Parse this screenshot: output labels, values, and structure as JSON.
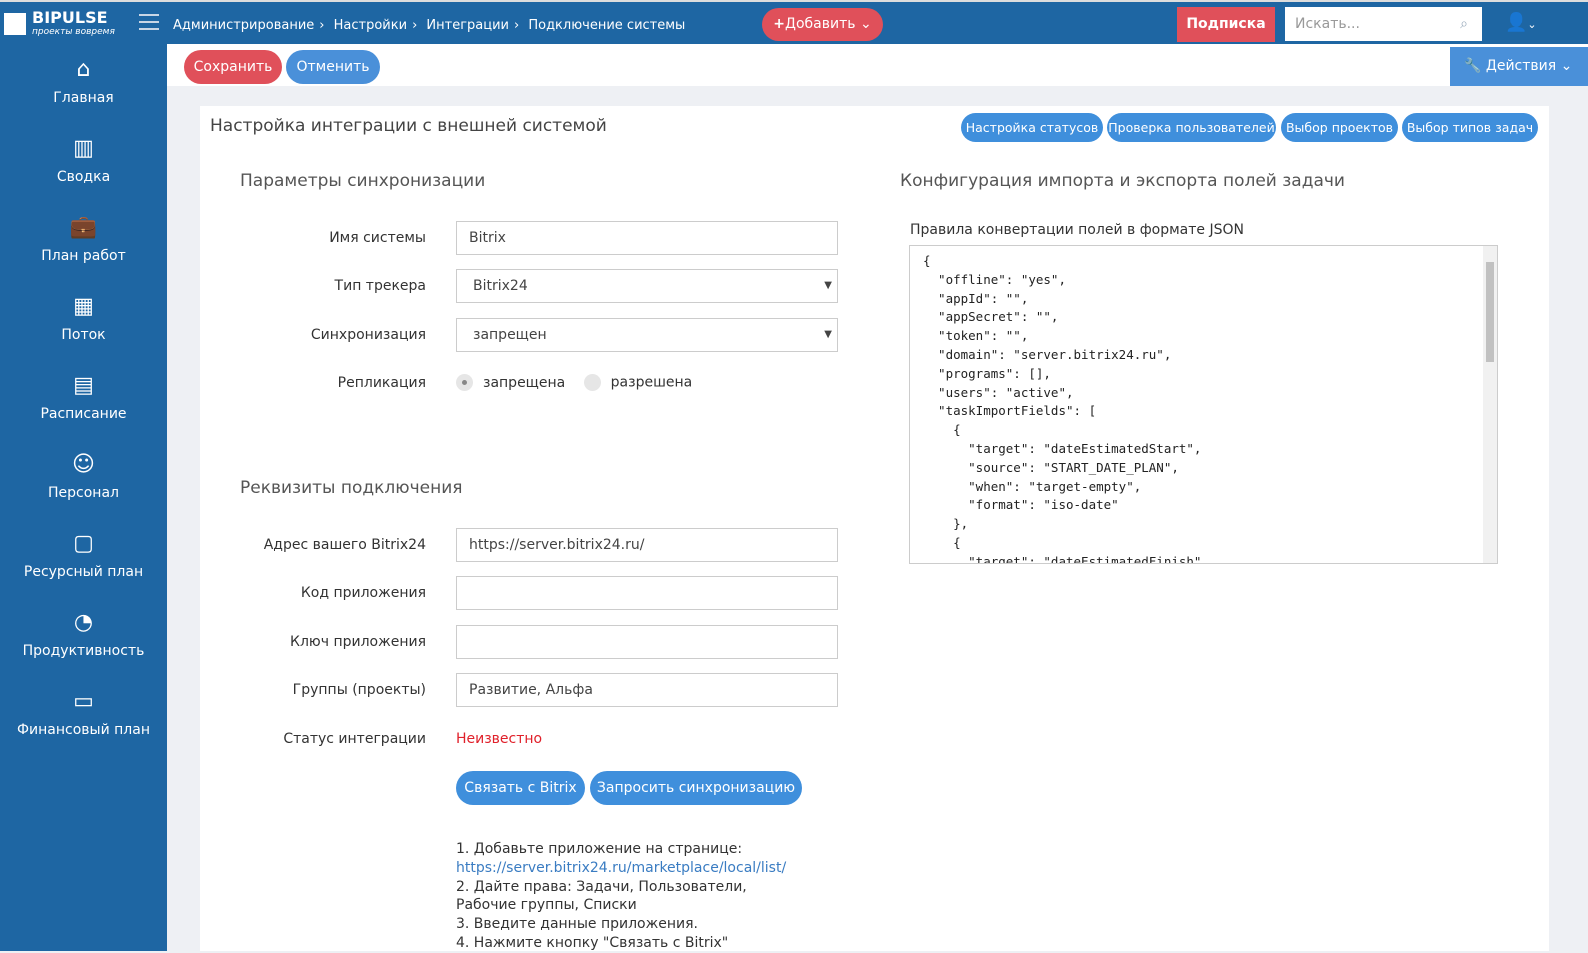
{
  "header": {
    "logo": "BIPULSE",
    "logo_tagline": "проекты вовремя",
    "breadcrumbs": [
      "Администрирование",
      "Настройки",
      "Интеграции",
      "Подключение системы"
    ],
    "add_label": "Добавить",
    "subscribe_label": "Подписка",
    "search_placeholder": "Искать..."
  },
  "sidebar": {
    "items": [
      {
        "label": "Главная",
        "icon": "⌂"
      },
      {
        "label": "Сводка",
        "icon": "▥"
      },
      {
        "label": "План работ",
        "icon": "💼"
      },
      {
        "label": "Поток",
        "icon": "▦"
      },
      {
        "label": "Расписание",
        "icon": "▤"
      },
      {
        "label": "Персонал",
        "icon": "☺"
      },
      {
        "label": "Ресурсный план",
        "icon": "▢"
      },
      {
        "label": "Продуктивность",
        "icon": "◔"
      },
      {
        "label": "Финансовый план",
        "icon": "▭"
      }
    ]
  },
  "toolbar": {
    "save": "Сохранить",
    "cancel": "Отменить",
    "actions": "Действия"
  },
  "card": {
    "title": "Настройка интеграции с внешней системой",
    "tabs": [
      "Настройка статусов",
      "Проверка пользователей",
      "Выбор проектов",
      "Выбор типов задач"
    ]
  },
  "sync": {
    "title": "Параметры синхронизации",
    "system_name_label": "Имя системы",
    "system_name": "Bitrix",
    "tracker_label": "Тип трекера",
    "tracker": "Bitrix24",
    "sync_label": "Синхронизация",
    "sync": "запрещен",
    "replication_label": "Репликация",
    "replication_off": "запрещена",
    "replication_on": "разрешена"
  },
  "conn": {
    "title": "Реквизиты подключения",
    "address_label": "Адрес вашего Bitrix24",
    "address": "https://server.bitrix24.ru/",
    "code_label": "Код приложения",
    "code": "",
    "key_label": "Ключ приложения",
    "key": "",
    "groups_label": "Группы (проекты)",
    "groups": "Развитие, Альфа",
    "status_label": "Статус интеграции",
    "status": "Неизвестно",
    "link_btn": "Связать с Bitrix",
    "sync_btn": "Запросить синхронизацию"
  },
  "instructions": {
    "step1": "1. Добавьте приложение на странице:",
    "link": "https://server.bitrix24.ru/marketplace/local/list/",
    "step2": "2. Дайте права: Задачи, Пользователи, Рабочие группы, Списки",
    "step3": "3. Введите данные приложения.",
    "step4": "4. Нажмите кнопку \"Связать с Bitrix\""
  },
  "config": {
    "title": "Конфигурация импорта и экспорта полей задачи",
    "json_label": "Правила конвертации полей в формате JSON",
    "json": "{\n  \"offline\": \"yes\",\n  \"appId\": \"\",\n  \"appSecret\": \"\",\n  \"token\": \"\",\n  \"domain\": \"server.bitrix24.ru\",\n  \"programs\": [],\n  \"users\": \"active\",\n  \"taskImportFields\": [\n    {\n      \"target\": \"dateEstimatedStart\",\n      \"source\": \"START_DATE_PLAN\",\n      \"when\": \"target-empty\",\n      \"format\": \"iso-date\"\n    },\n    {\n      \"target\": \"dateEstimatedFinish\","
  },
  "colors": {
    "brand": "#1e66a3",
    "danger": "#e0505a",
    "primary": "#3f8fdc"
  }
}
